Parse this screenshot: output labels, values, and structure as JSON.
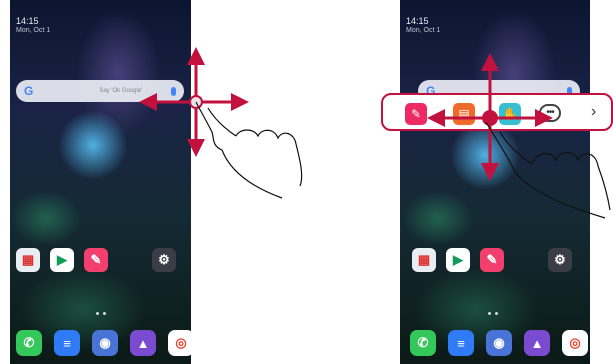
{
  "status": {
    "time": "14:15",
    "date": "Mon, Oct 1"
  },
  "search": {
    "logo": "G",
    "hint": "Say 'Ok Google'"
  },
  "apps": [
    {
      "name": "folder-icon",
      "label": "Google",
      "color": "#e9eef5",
      "glyph": "▦"
    },
    {
      "name": "play-store-icon",
      "label": "Play Store",
      "color": "#ffffff",
      "glyph": "▶"
    },
    {
      "name": "pen-icon",
      "label": "QuickMemo+",
      "color": "#f23f6e",
      "glyph": "✎"
    },
    {
      "name": "flower-icon",
      "label": "",
      "color": "#7b8c5a",
      "glyph": ""
    },
    {
      "name": "settings-icon",
      "label": "Settings",
      "color": "#3a3d45",
      "glyph": "⚙"
    }
  ],
  "dock": [
    {
      "name": "phone-icon",
      "color": "#34c759",
      "glyph": "✆"
    },
    {
      "name": "messages-icon",
      "color": "#2f7bf5",
      "glyph": "≡"
    },
    {
      "name": "camera-icon",
      "color": "#4a73d8",
      "glyph": "◉"
    },
    {
      "name": "gallery-icon",
      "color": "#7a4bd1",
      "glyph": "▲"
    },
    {
      "name": "chrome-icon",
      "color": "#ffffff",
      "glyph": "◎"
    }
  ],
  "quicktools": [
    {
      "name": "qmemo-icon",
      "color": "#ee2a64",
      "glyph": "✎"
    },
    {
      "name": "notes-icon",
      "color": "#f06a2a",
      "glyph": "▤"
    },
    {
      "name": "capture-icon",
      "color": "#37bfd1",
      "glyph": "✋"
    }
  ],
  "more": "•••",
  "chevron": "›"
}
